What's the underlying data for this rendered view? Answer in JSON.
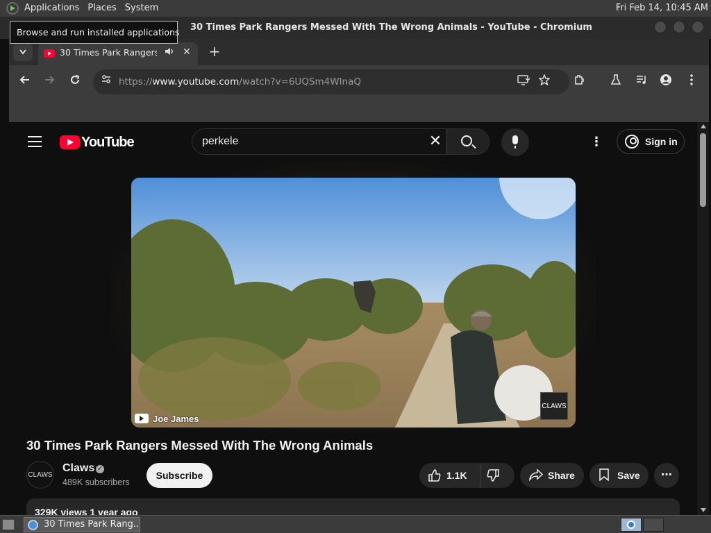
{
  "top_panel": {
    "menus": [
      "Applications",
      "Places",
      "System"
    ],
    "clock": "Fri Feb 14, 10:45 AM"
  },
  "tooltip": "Browse and run installed applications",
  "window": {
    "title": "30 Times Park Rangers Messed With The Wrong Animals - YouTube - Chromium"
  },
  "tab": {
    "title": "30 Times Park Rangers Messed With The Wrong Animals",
    "audio_icon": "speaker-icon",
    "close": "✕",
    "new_tab": "+"
  },
  "toolbar": {
    "url_scheme": "https://",
    "url_host": "www.youtube.com",
    "url_path": "/watch?v=6UQSm4WInaQ"
  },
  "youtube": {
    "logo_text": "YouTube",
    "search_value": "perkele",
    "sign_in": "Sign in",
    "video": {
      "watermark": "Joe James",
      "corner_logo": "CLAWS",
      "title": "30 Times Park Rangers Messed With The Wrong Animals"
    },
    "channel": {
      "name": "Claws",
      "avatar_text": "CLAWS",
      "subscribers": "489K subscribers",
      "verified": true
    },
    "actions": {
      "subscribe": "Subscribe",
      "likes": "1.1K",
      "share": "Share",
      "save": "Save"
    },
    "description": {
      "meta": "329K views  1 year ago"
    }
  },
  "taskbar": {
    "task_label": "30 Times Park Rang..."
  },
  "colors": {
    "yt_red": "#ff0033",
    "page_bg": "#0f0f0f",
    "chrome_toolbar": "#3c3c3c"
  }
}
